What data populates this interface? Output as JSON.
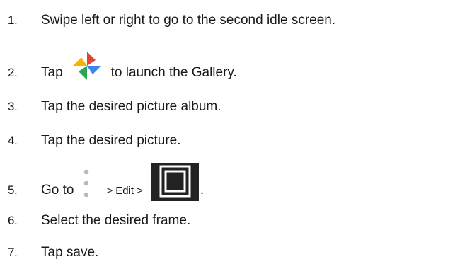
{
  "steps": [
    {
      "num": "1.",
      "text": "Swipe left or right to go to the second idle screen."
    },
    {
      "num": "2.",
      "before": "Tap",
      "after": "to launch the Gallery.",
      "icon": "gallery-pinwheel-icon"
    },
    {
      "num": "3.",
      "text": "Tap the desired picture album."
    },
    {
      "num": "4.",
      "text": "Tap the desired picture."
    },
    {
      "num": "5.",
      "before": "Go to",
      "sep1": ">",
      "edit": "Edit",
      "sep2": ">",
      "after": ".",
      "icons": [
        "more-vertical-icon",
        "frame-icon"
      ]
    },
    {
      "num": "6.",
      "text": "Select the desired frame."
    },
    {
      "num": "7.",
      "text": "Tap save."
    }
  ]
}
